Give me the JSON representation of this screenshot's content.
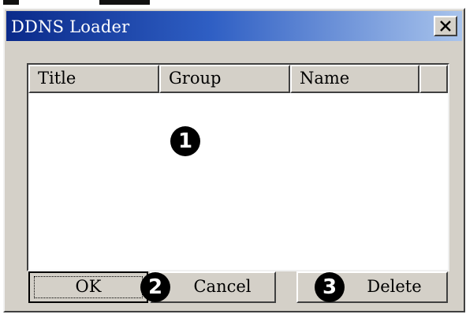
{
  "window": {
    "title": "DDNS Loader",
    "close_icon": "close-icon"
  },
  "list": {
    "columns": [
      "Title",
      "Group",
      "Name",
      ""
    ],
    "rows": []
  },
  "buttons": {
    "ok": "OK",
    "cancel": "Cancel",
    "delete": "Delete"
  },
  "markers": [
    "❶",
    "❷",
    "❸"
  ],
  "colors": {
    "titlebar_start": "#0a2a8a",
    "titlebar_end": "#a9c4ec",
    "face": "#d4d0c8"
  }
}
